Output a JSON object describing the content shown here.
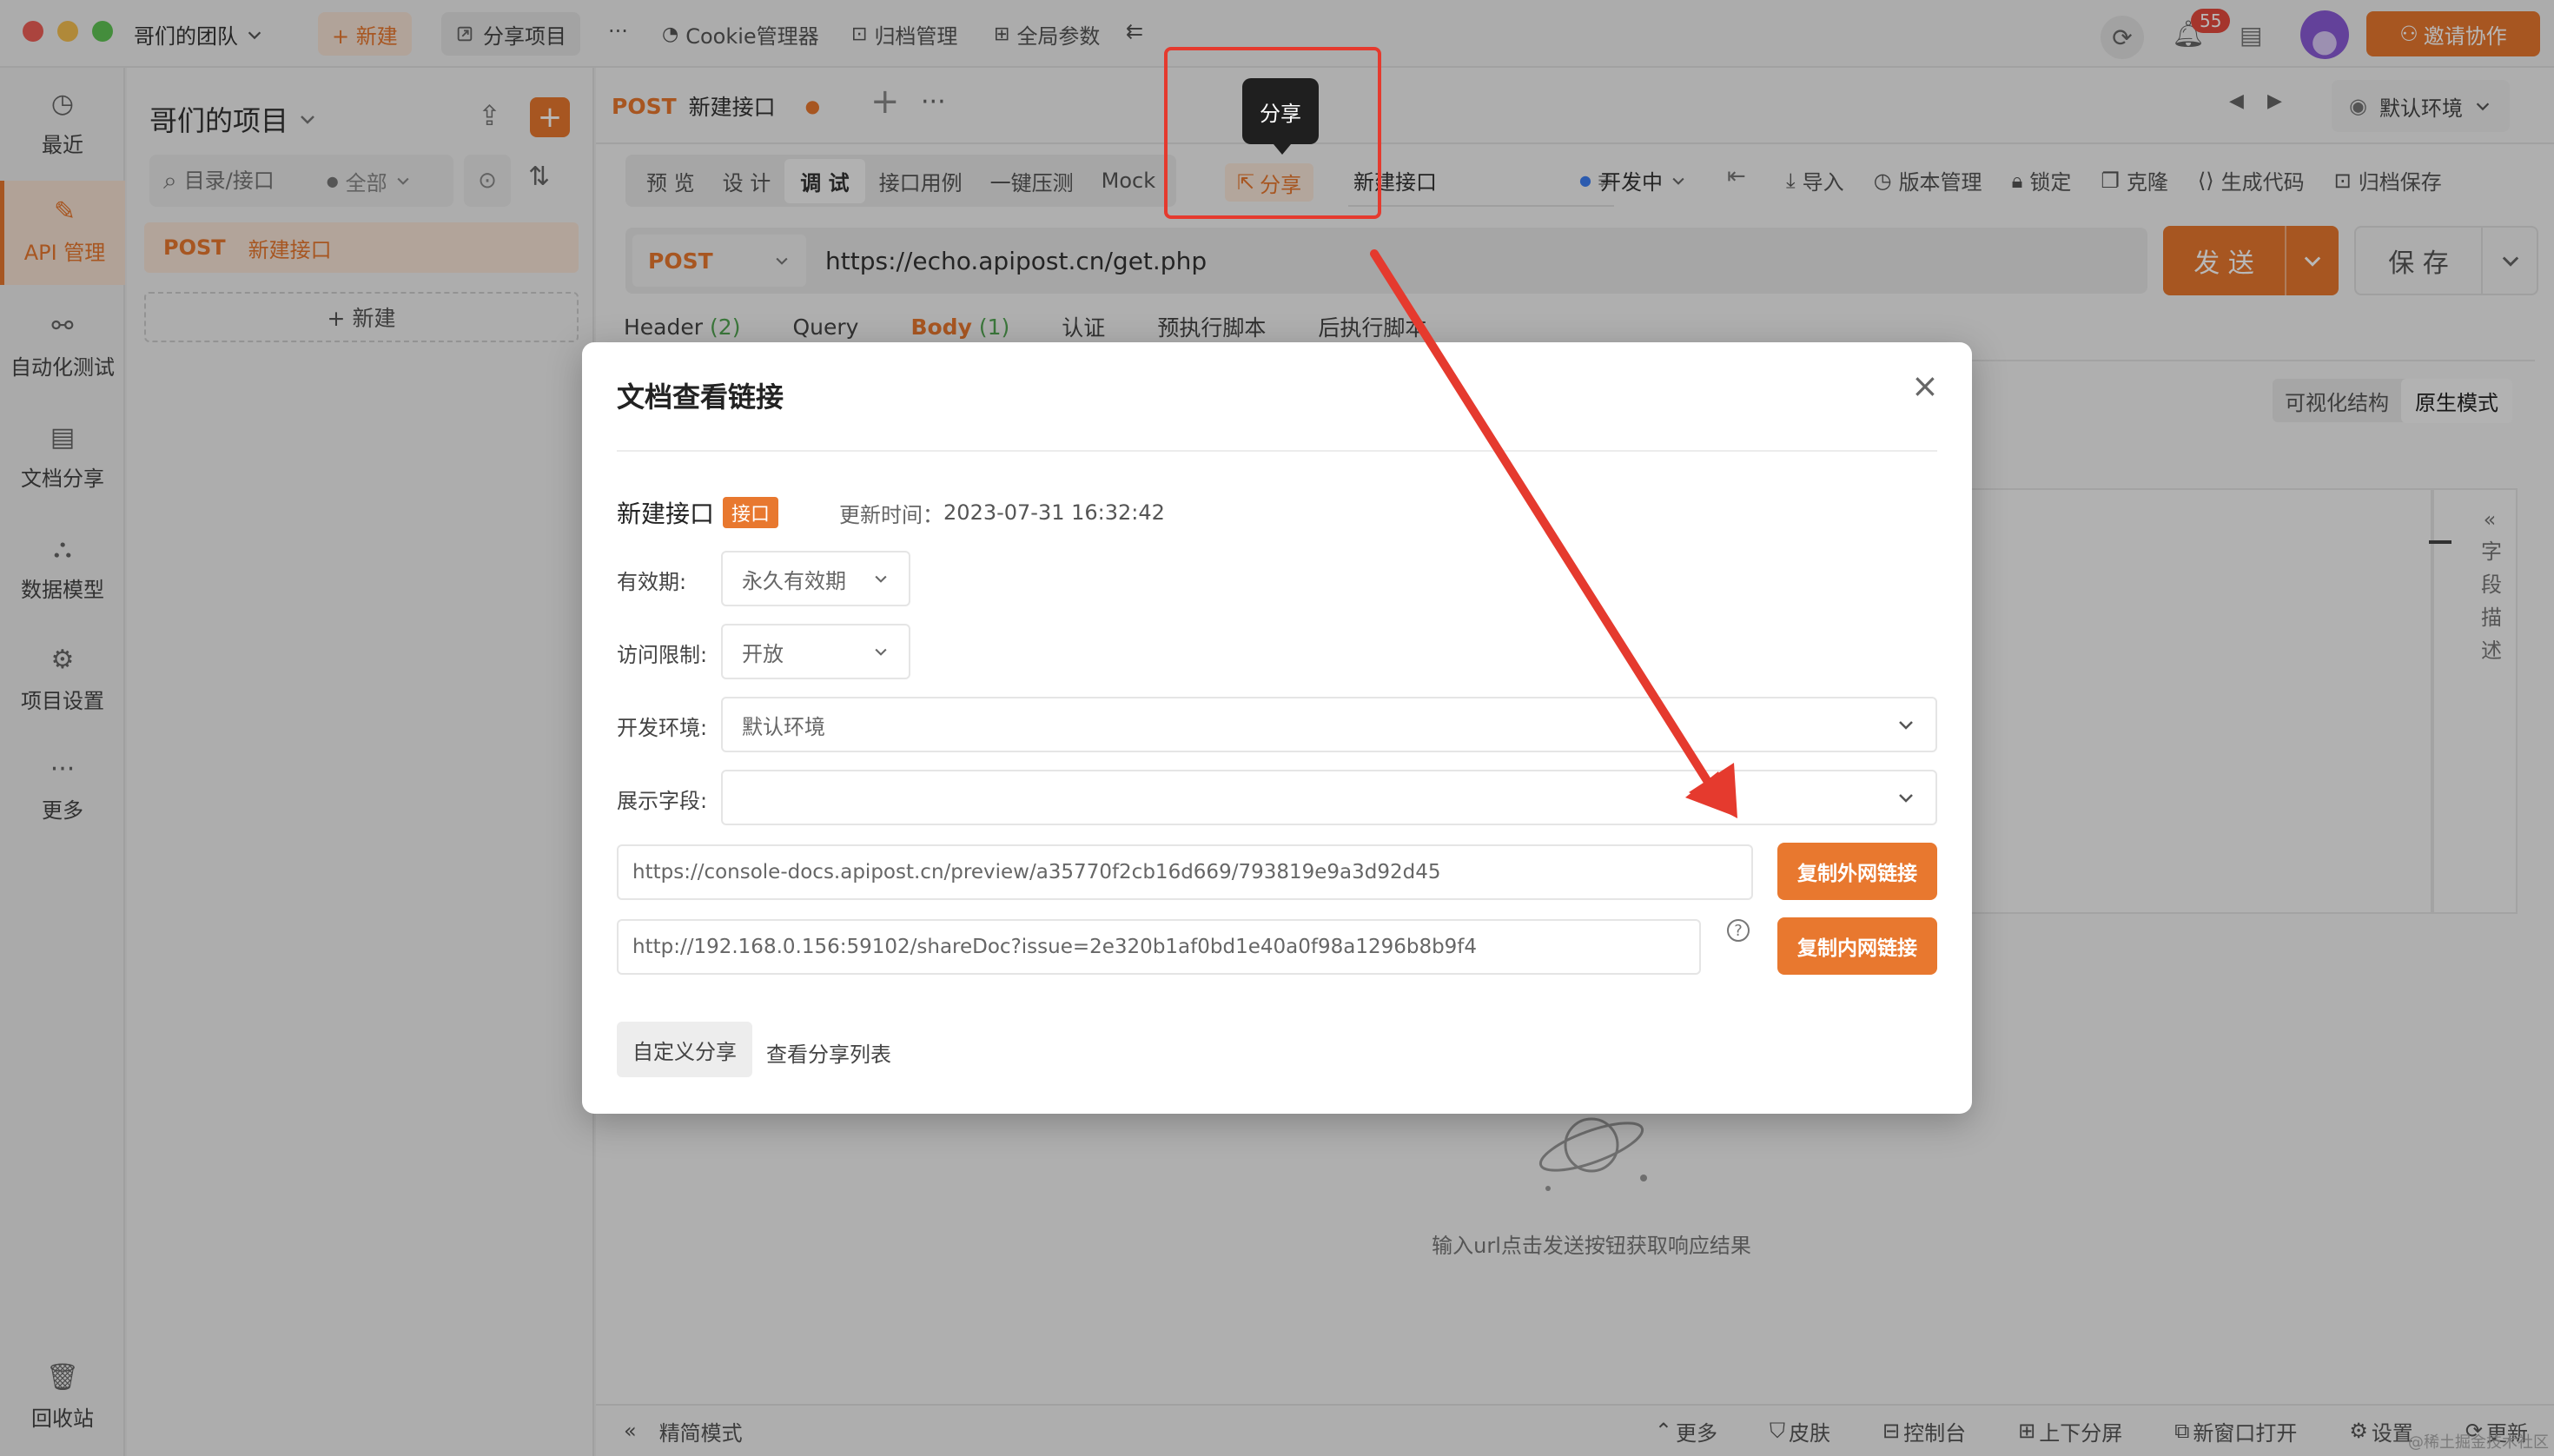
{
  "titlebar": {
    "team": "哥们的团队",
    "new_label": "+ 新建",
    "share_project": "分享项目",
    "more": "···",
    "cookie_manager": "Cookie管理器",
    "archive_manager": "归档管理",
    "global_params": "全局参数",
    "notif_count": "55",
    "invite": "邀请协作"
  },
  "sidebar": {
    "items": [
      {
        "label": "最近"
      },
      {
        "label": "API 管理"
      },
      {
        "label": "自动化测试"
      },
      {
        "label": "文档分享"
      },
      {
        "label": "数据模型"
      },
      {
        "label": "项目设置"
      },
      {
        "label": "更多"
      }
    ],
    "trash": "回收站"
  },
  "project": {
    "title": "哥们的项目",
    "search_placeholder": "目录/接口",
    "filter_all": "全部",
    "tree_method": "POST",
    "tree_name": "新建接口",
    "new_button": "+ 新建"
  },
  "main": {
    "tab_method": "POST",
    "tab_name": "新建接口",
    "env": "默认环境",
    "mode_tabs": [
      "预 览",
      "设 计",
      "调 试",
      "接口用例",
      "一键压测",
      "Mock"
    ],
    "share_label": "分享",
    "api_name_input": "新建接口",
    "status": "开发中",
    "toolbar": [
      "导入",
      "版本管理",
      "锁定",
      "克隆",
      "生成代码",
      "归档保存"
    ],
    "method": "POST",
    "url": "https://echo.apipost.cn/get.php",
    "send": "发 送",
    "save": "保 存",
    "req_tabs": {
      "header": "Header",
      "header_count": "(2)",
      "query": "Query",
      "body": "Body",
      "body_count": "(1)",
      "auth": "认证",
      "pre_script": "预执行脚本",
      "post_script": "后执行脚本"
    },
    "view_visual": "可视化结构",
    "view_raw": "原生模式",
    "field_desc": "字段描述",
    "empty_hint": "输入url点击发送按钮获取响应结果"
  },
  "bottombar": {
    "simple_mode": "精简模式",
    "more": "更多",
    "skin": "皮肤",
    "console": "控制台",
    "split": "上下分屏",
    "new_window": "新窗口打开",
    "settings": "设置",
    "update": "更新",
    "watermark": "@稀土掘金技术社区"
  },
  "tooltip": "分享",
  "modal": {
    "title": "文档查看链接",
    "api_name": "新建接口",
    "tag": "接口",
    "updated_label": "更新时间：",
    "updated_at": "2023-07-31 16:32:42",
    "validity_label": "有效期:",
    "validity_value": "永久有效期",
    "access_label": "访问限制:",
    "access_value": "开放",
    "env_label": "开发环境:",
    "env_value": "默认环境",
    "fields_label": "展示字段:",
    "fields_value": "",
    "public_link": "https://console-docs.apipost.cn/preview/a35770f2cb16d669/793819e9a3d92d45",
    "copy_public": "复制外网链接",
    "private_link": "http://192.168.0.156:59102/shareDoc?issue=2e320b1af0bd1e40a0f98a1296b8b9f4",
    "copy_private": "复制内网链接",
    "custom_share": "自定义分享",
    "view_share_list": "查看分享列表"
  },
  "colors": {
    "accent": "#e8782f",
    "annotation": "#e53a2e",
    "success": "#52a552"
  }
}
